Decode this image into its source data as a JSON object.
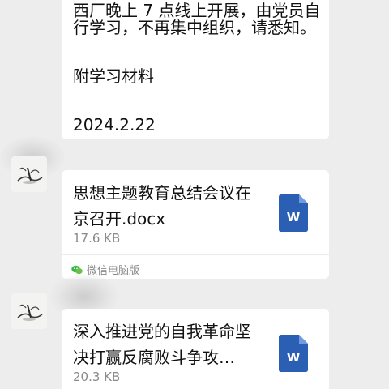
{
  "top_message": {
    "line1": "西厂晚上 7 点线上开展，由党员自",
    "line2": "行学习，不再集中组织，请悉知。",
    "line3": "附学习材料",
    "line4": "2024.2.22"
  },
  "messages": [
    {
      "file_title_line1": "思想主题教育总结会议在",
      "file_title_line2": "京召开.docx",
      "file_size": "17.6 KB",
      "file_icon_letter": "W",
      "source_label": "微信电脑版"
    },
    {
      "file_title_line1": "深入推进党的自我革命坚",
      "file_title_line2": "决打赢反腐败斗争攻…",
      "file_size": "20.3 KB",
      "file_icon_letter": "W"
    }
  ],
  "colors": {
    "background": "#ededed",
    "bubble": "#ffffff",
    "word_blue": "#2b5fb3",
    "muted_text": "#8a8a8a",
    "wechat_green": "#39b54a"
  },
  "icons": [
    "word-file-icon",
    "wechat-logo-icon",
    "ink-painting-avatar"
  ]
}
